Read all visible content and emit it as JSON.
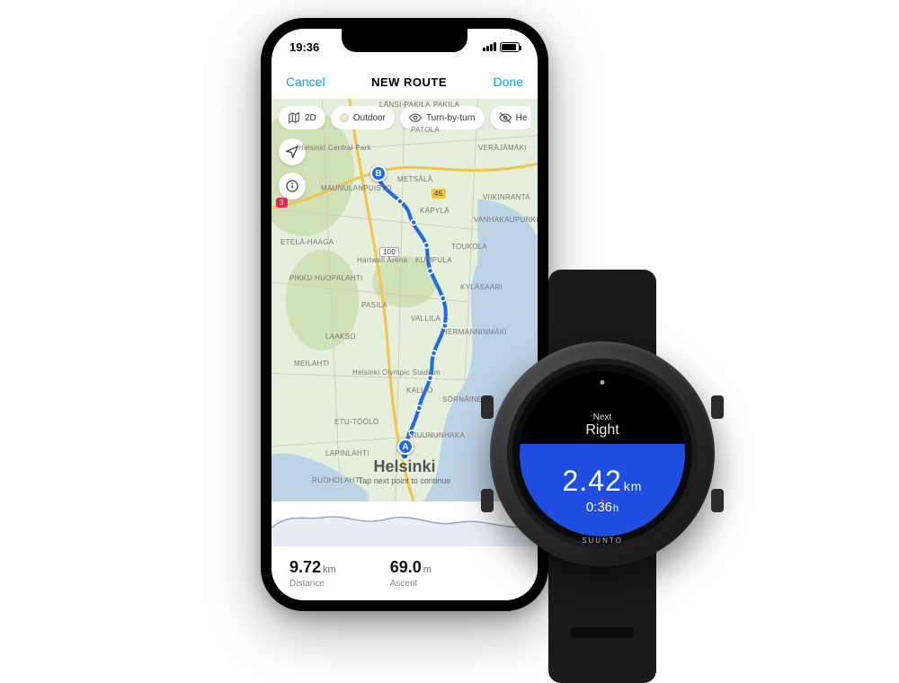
{
  "phone": {
    "status": {
      "time": "19:36"
    },
    "nav": {
      "cancel": "Cancel",
      "title": "NEW ROUTE",
      "done": "Done"
    },
    "chips": {
      "mode2d": "2D",
      "outdoor": "Outdoor",
      "turnbyturn": "Turn-by-turn",
      "heatmap": "He"
    },
    "map": {
      "city": "Helsinki",
      "hint": "Tap next point to continue",
      "labels": {
        "lansi_pakila": "LÄNSI-PAKILA",
        "pakila": "PAKILA",
        "helsinki_central_park": "Helsinki Central Park",
        "maunula": "MAUNULANPUISTO",
        "metsala": "METSÄLÄ",
        "patola": "PATOLA",
        "veräjämäki": "VERÄJÄMÄKI",
        "lansi_herttoniemi": "",
        "kapyla": "KÄPYLÄ",
        "viikinranta": "VIIKINRANTA",
        "vanhakaupunki": "VANHAKAUPUNKI",
        "etela_haaga": "ETELÄ-HAAGA",
        "pikku_huopalahti": "PIKKU HUOPALAHTI",
        "hartwall": "Hartwall Arena",
        "kumpula": "KUMPULA",
        "toukola": "TOUKOLA",
        "kylasaari": "KYLÄSAARI",
        "pasila": "PASILA",
        "vallila": "VALLILA",
        "hermanni": "HERMANNINMÄKI",
        "laakso": "LAAKSO",
        "meilahti": "MEILAHTI",
        "olympic": "Helsinki Olympic Stadium",
        "kallio": "KALLIO",
        "etu_toolo": "ETU-TÖÖLÖ",
        "sornainen": "SÖRNÄINEN",
        "lapinlahti": "LAPINLAHTI",
        "kruununhaka": "KRUUNUNHAKA",
        "ruoholahti": "RUOHOLAHTI",
        "road3": "3",
        "road45": "45",
        "road100": "100"
      },
      "points": {
        "A": "A",
        "B": "B"
      }
    },
    "stats": {
      "distance_value": "9.72",
      "distance_unit": "km",
      "distance_label": "Distance",
      "ascent_value": "69.0",
      "ascent_unit": "m",
      "ascent_label": "Ascent"
    }
  },
  "watch": {
    "next_label": "Next",
    "direction": "Right",
    "distance_value": "2.42",
    "distance_unit": "km",
    "time_value": "0:36",
    "time_unit": "h",
    "brand": "SUUNTO"
  }
}
